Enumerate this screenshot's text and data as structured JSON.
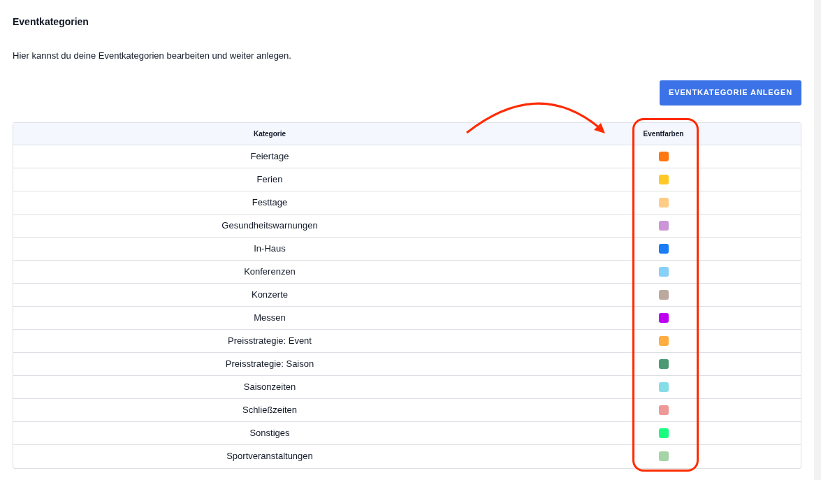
{
  "title": "Eventkategorien",
  "description": "Hier kannst du deine Eventkategorien bearbeiten und weiter anlegen.",
  "create_button": "EVENTKATEGORIE ANLEGEN",
  "table": {
    "columns": [
      "Kategorie",
      "Eventfarben"
    ],
    "rows": [
      {
        "name": "Feiertage",
        "color": "#ff7711"
      },
      {
        "name": "Ferien",
        "color": "#ffc824"
      },
      {
        "name": "Festtage",
        "color": "#ffcc88"
      },
      {
        "name": "Gesundheitswarnungen",
        "color": "#cc96d6"
      },
      {
        "name": "In-Haus",
        "color": "#1a7cf6"
      },
      {
        "name": "Konferenzen",
        "color": "#87d0f9"
      },
      {
        "name": "Konzerte",
        "color": "#bba9a0"
      },
      {
        "name": "Messen",
        "color": "#bd00f2"
      },
      {
        "name": "Preisstrategie: Event",
        "color": "#ffad40"
      },
      {
        "name": "Preisstrategie: Saison",
        "color": "#4b9a73"
      },
      {
        "name": "Saisonzeiten",
        "color": "#85dde8"
      },
      {
        "name": "Schließzeiten",
        "color": "#ee9898"
      },
      {
        "name": "Sonstiges",
        "color": "#1afc7f"
      },
      {
        "name": "Sportveranstaltungen",
        "color": "#a5d4a6"
      }
    ]
  }
}
